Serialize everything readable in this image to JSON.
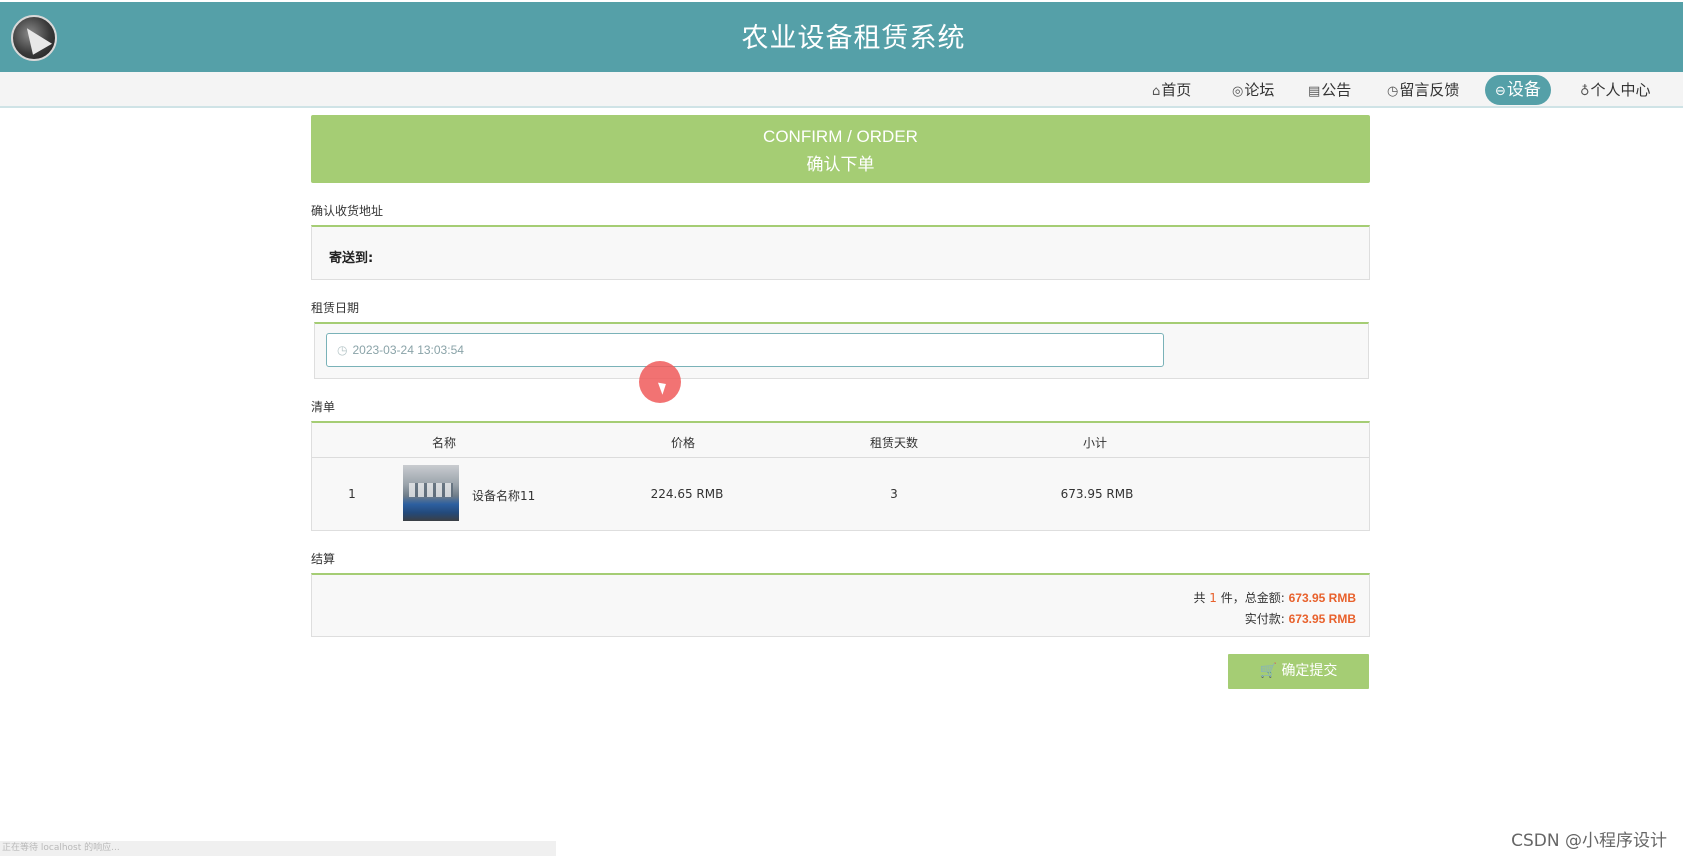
{
  "header": {
    "site_title": "农业设备租赁系统"
  },
  "nav": {
    "items": [
      {
        "label": "首页",
        "icon": "home-icon",
        "glyph": "⌂"
      },
      {
        "label": "论坛",
        "icon": "forum-icon",
        "glyph": "◎"
      },
      {
        "label": "公告",
        "icon": "notice-icon",
        "glyph": "▤"
      },
      {
        "label": "留言反馈",
        "icon": "feedback-icon",
        "glyph": "◷"
      },
      {
        "label": "设备",
        "icon": "device-icon",
        "glyph": "⊖",
        "active": true
      },
      {
        "label": "个人中心",
        "icon": "user-icon",
        "glyph": "♁"
      }
    ]
  },
  "banner": {
    "title_en": "CONFIRM / ORDER",
    "title_zh": "确认下单"
  },
  "address": {
    "section_label": "确认收货地址",
    "ship_to_label": "寄送到:"
  },
  "rental_date": {
    "section_label": "租赁日期",
    "value": "2023-03-24 13:03:54"
  },
  "list": {
    "section_label": "清单",
    "headers": {
      "name": "名称",
      "price": "价格",
      "days": "租赁天数",
      "subtotal": "小计"
    },
    "rows": [
      {
        "index": "1",
        "name": "设备名称11",
        "price": "224.65 RMB",
        "days": "3",
        "subtotal": "673.95 RMB"
      }
    ]
  },
  "settlement": {
    "section_label": "结算",
    "count_prefix": "共",
    "count": "1",
    "count_suffix": "件，总金额:",
    "total": "673.95 RMB",
    "paid_label": "实付款:",
    "paid": "673.95 RMB"
  },
  "submit": {
    "label": "确定提交",
    "icon": "cart-icon"
  },
  "status_bar": {
    "text": "正在等待 localhost 的响应..."
  },
  "watermark": {
    "text": "CSDN @小程序设计"
  },
  "colors": {
    "header": "#55a0a8",
    "accent_green": "#a5cd74",
    "price_orange": "#e8612c"
  }
}
